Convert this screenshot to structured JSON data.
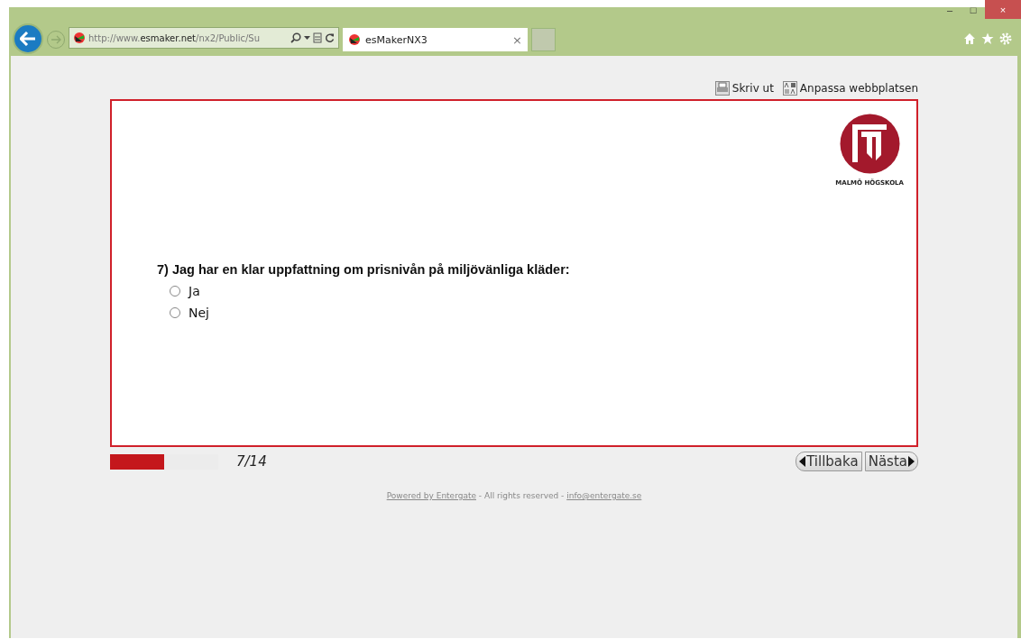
{
  "browser": {
    "address": "http://www.**esmaker.net**/nx2/Public/Su",
    "tab_title": "esMakerNX3",
    "tab_close": "×",
    "window_controls": [
      "–",
      "□",
      "×"
    ]
  },
  "toolbar": [
    {
      "kind": "print",
      "label": "Skriv ut"
    },
    {
      "kind": "customize",
      "label": "Anpassa webbplatsen"
    }
  ],
  "logo": {
    "caption": "MALMÖ HÖGSKOLA"
  },
  "question": {
    "text": "7) Jag har en klar uppfattning om prisnivån på miljövänliga kläder:",
    "options": [
      {
        "label": "Ja",
        "selected": false
      },
      {
        "label": "Nej",
        "selected": false
      }
    ]
  },
  "progress": {
    "level": 0.5,
    "reading": "7/14"
  },
  "nav": [
    {
      "kind": "back",
      "label": "Tillbaka"
    },
    {
      "kind": "next",
      "label": "Nästa"
    }
  ],
  "footer": {
    "link1": "Powered by Entergate",
    "text": " - All rights reserved - ",
    "link2": "info@entergate.se"
  }
}
